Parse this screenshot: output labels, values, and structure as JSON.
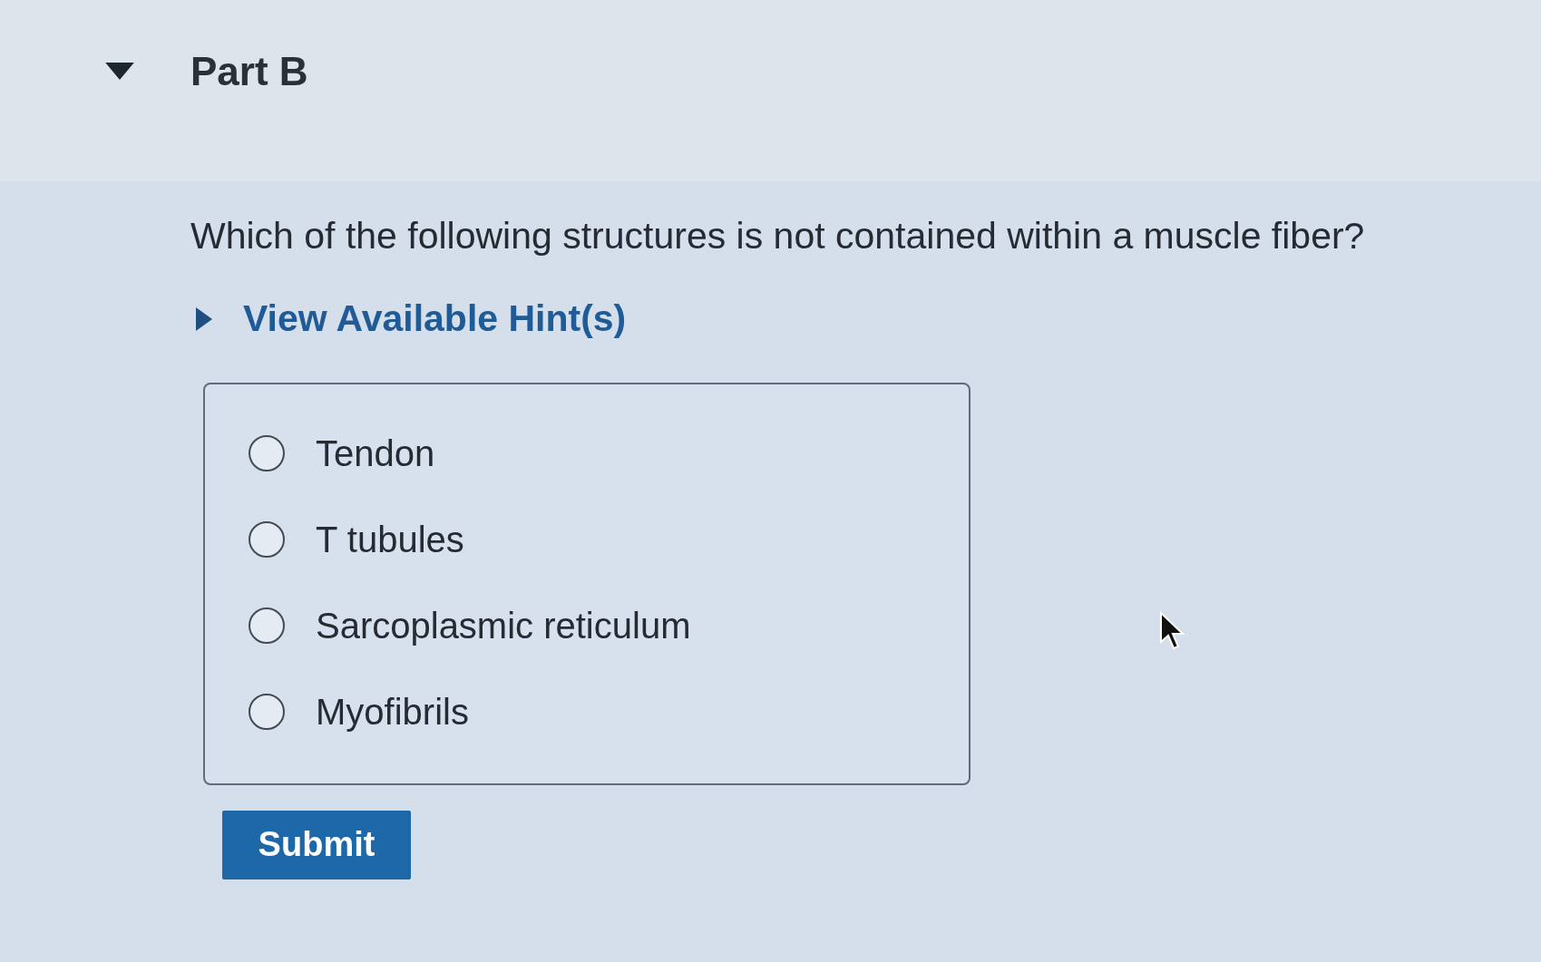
{
  "part": {
    "title": "Part B",
    "expanded": true
  },
  "question": "Which of the following structures is not contained within a muscle fiber?",
  "hints": {
    "label": "View Available Hint(s)",
    "expanded": false
  },
  "options": [
    {
      "label": "Tendon",
      "selected": false
    },
    {
      "label": "T tubules",
      "selected": false
    },
    {
      "label": "Sarcoplasmic reticulum",
      "selected": false
    },
    {
      "label": "Myofibrils",
      "selected": false
    }
  ],
  "submit": {
    "label": "Submit"
  }
}
